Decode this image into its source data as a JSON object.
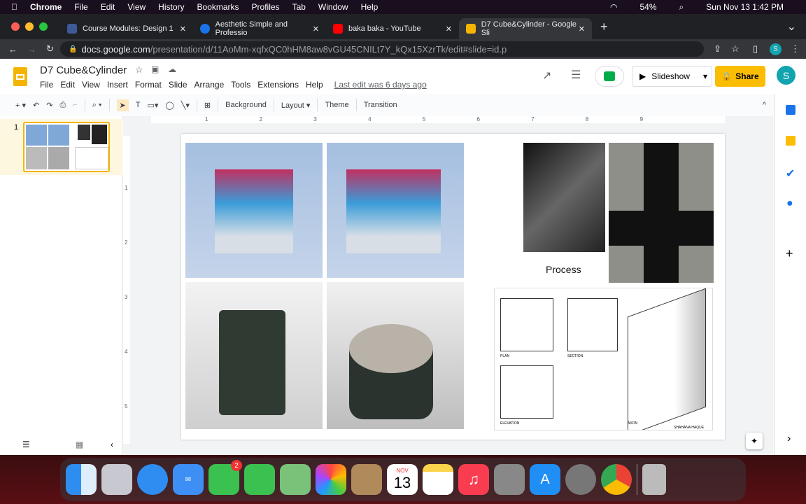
{
  "menubar": {
    "app": "Chrome",
    "items": [
      "File",
      "Edit",
      "View",
      "History",
      "Bookmarks",
      "Profiles",
      "Tab",
      "Window",
      "Help"
    ],
    "battery": "54%",
    "datetime": "Sun Nov 13  1:42 PM"
  },
  "tabs": [
    {
      "title": "Course Modules: Design 1",
      "color": "#3d5a98"
    },
    {
      "title": "Aesthetic Simple and Professio",
      "color": "#1a73e8"
    },
    {
      "title": "baka baka - YouTube",
      "color": "#ff0000"
    },
    {
      "title": "D7 Cube&Cylinder - Google Sli",
      "color": "#f4b400"
    }
  ],
  "address": {
    "host": "docs.google.com",
    "path": "/presentation/d/11AoMm-xqfxQC0hHM8aw8vGU45CNILt7Y_kQx15XzrTk/edit#slide=id.p",
    "profile": "S"
  },
  "doc": {
    "title": "D7 Cube&Cylinder",
    "menus": [
      "File",
      "Edit",
      "View",
      "Insert",
      "Format",
      "Slide",
      "Arrange",
      "Tools",
      "Extensions",
      "Help"
    ],
    "last_edit": "Last edit was 6 days ago",
    "slideshow": "Slideshow",
    "share": "Share",
    "avatar": "S"
  },
  "toolbar": {
    "background": "Background",
    "layout": "Layout",
    "theme": "Theme",
    "transition": "Transition"
  },
  "filmstrip": {
    "slide_number": "1"
  },
  "ruler": {
    "h": [
      "1",
      "2",
      "3",
      "4",
      "5",
      "6",
      "7",
      "8",
      "9"
    ],
    "v": [
      "1",
      "2",
      "3",
      "4",
      "5"
    ]
  },
  "slide": {
    "process_label": "Process",
    "drawing_labels": [
      "PLAN",
      "SECTION",
      "ELEVATION",
      "AXON",
      "SHAHANA HAQUE"
    ]
  },
  "dock": {
    "facetime_badge": "2",
    "calendar_month": "NOV",
    "calendar_day": "13"
  },
  "colors": {
    "accent": "#f4b400",
    "share": "#fbbc04"
  }
}
